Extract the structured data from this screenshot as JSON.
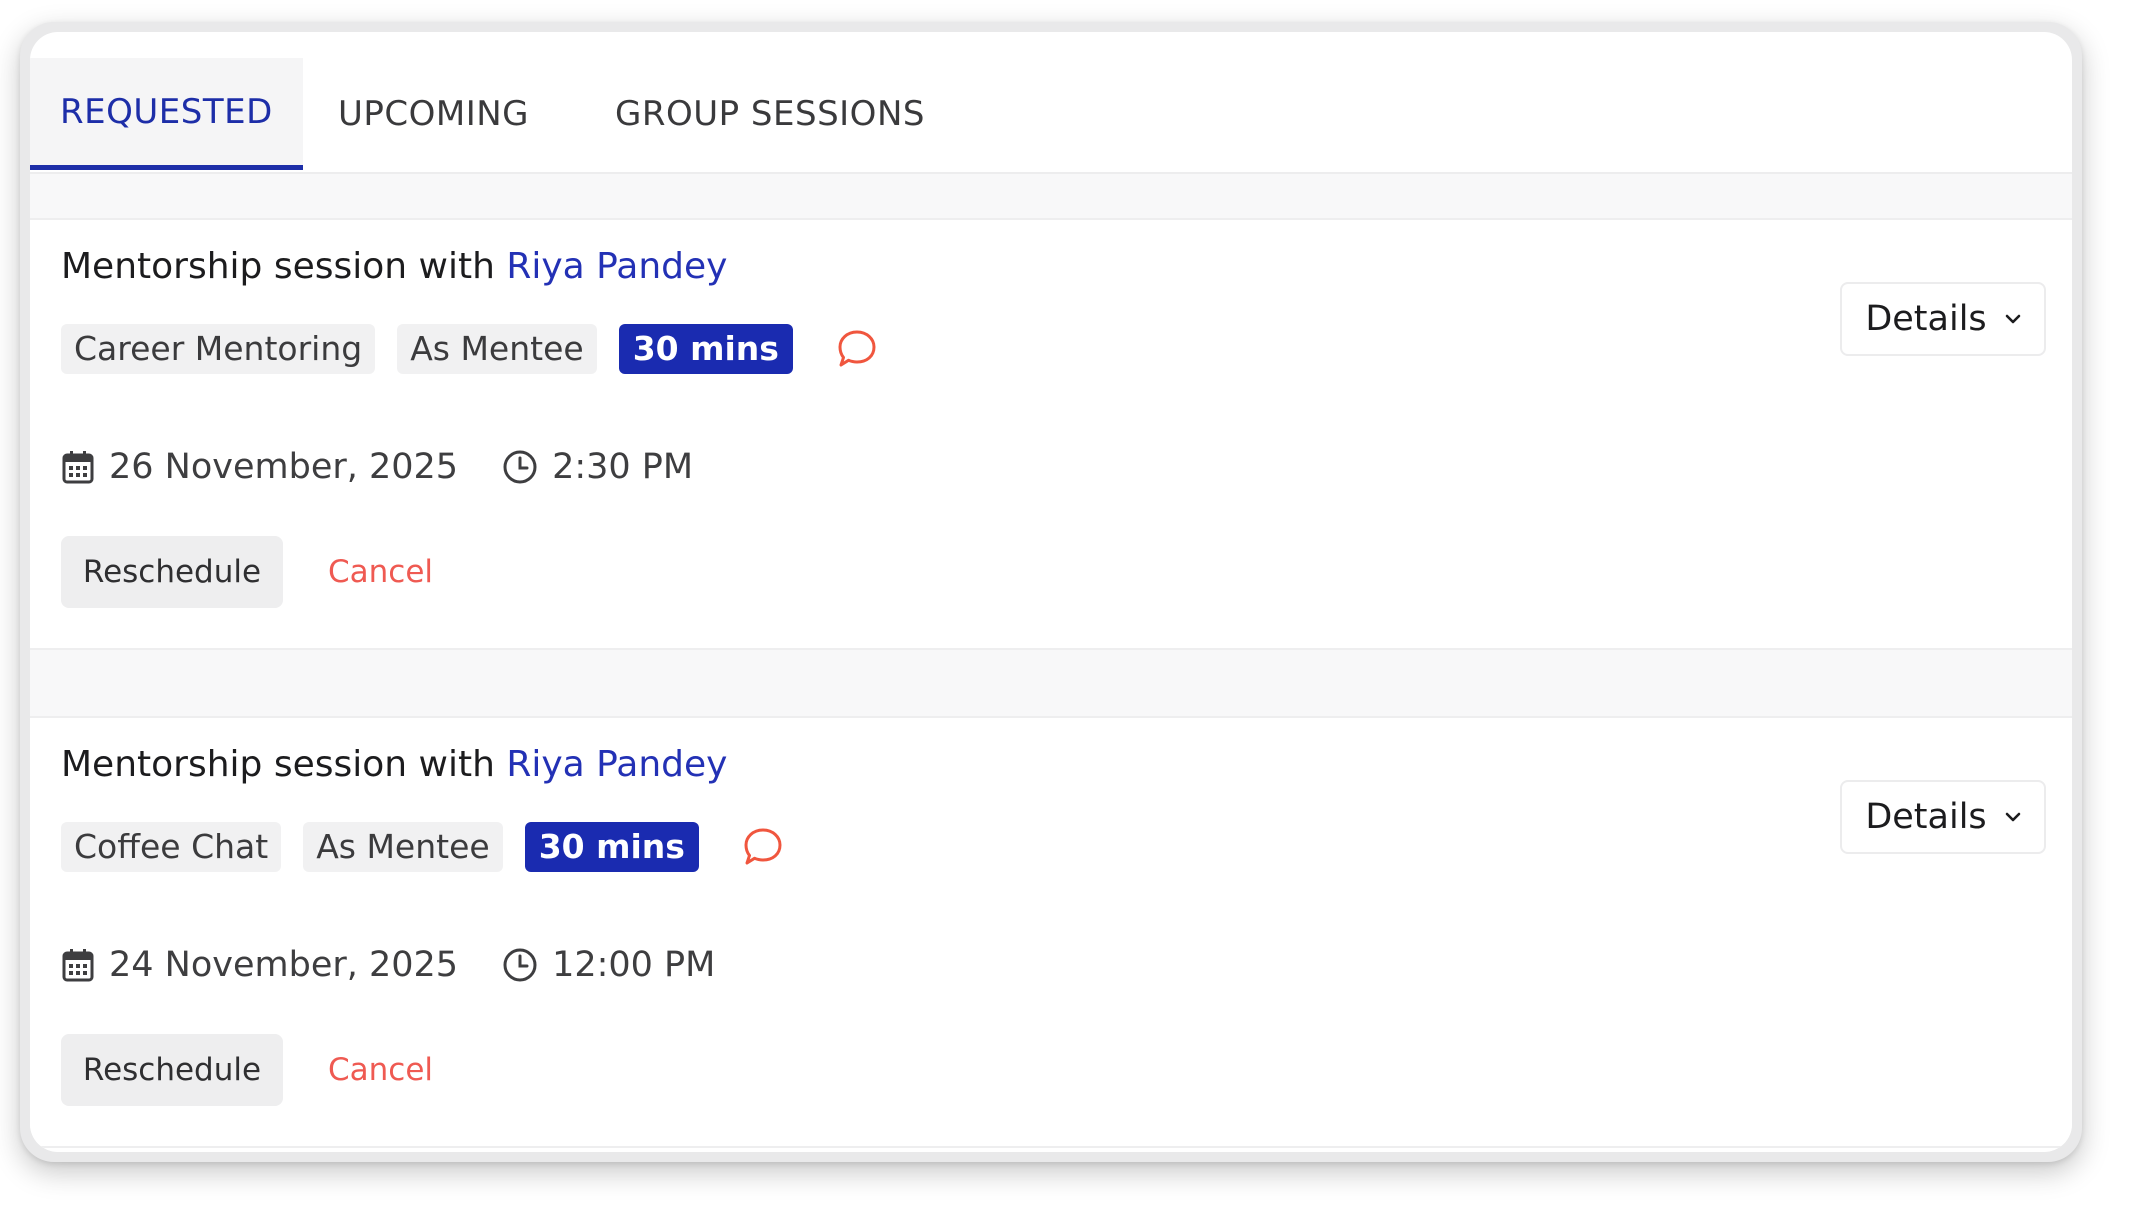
{
  "tabs": [
    {
      "label": "REQUESTED",
      "active": true
    },
    {
      "label": "UPCOMING",
      "active": false
    },
    {
      "label": "GROUP SESSIONS",
      "active": false
    }
  ],
  "sessions": [
    {
      "title_prefix": "Mentorship session with ",
      "mentor_name": "Riya Pandey",
      "tags": [
        "Career Mentoring",
        "As Mentee"
      ],
      "duration": "30 mins",
      "date": "26 November, 2025",
      "time": "2:30 PM",
      "reschedule_label": "Reschedule",
      "cancel_label": "Cancel",
      "details_label": "Details"
    },
    {
      "title_prefix": "Mentorship session with ",
      "mentor_name": "Riya Pandey",
      "tags": [
        "Coffee Chat",
        "As Mentee"
      ],
      "duration": "30 mins",
      "date": "24 November, 2025",
      "time": "12:00 PM",
      "reschedule_label": "Reschedule",
      "cancel_label": "Cancel",
      "details_label": "Details"
    }
  ],
  "colors": {
    "accent": "#1d2ea8",
    "link": "#2331b5",
    "cancel": "#ef5a52",
    "chat_icon": "#f0563e"
  },
  "icons": [
    "calendar-icon",
    "clock-icon",
    "chat-bubble-icon",
    "chevron-down-icon"
  ]
}
